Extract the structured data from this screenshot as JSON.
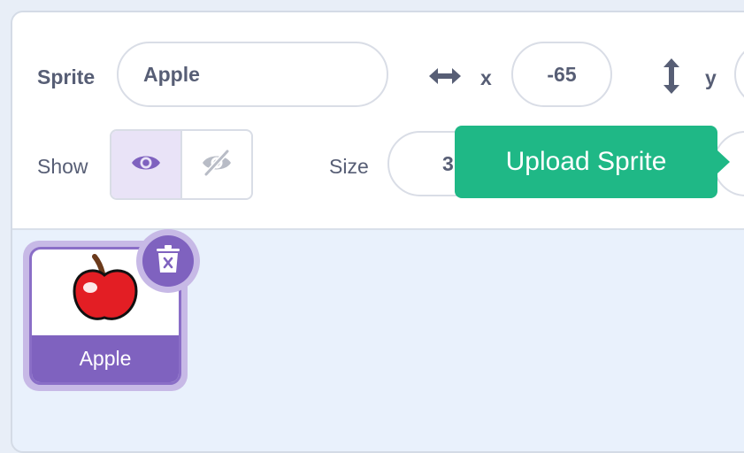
{
  "sprite_info": {
    "sprite_label": "Sprite",
    "sprite_name": "Apple",
    "x_label": "x",
    "x_value": "-65",
    "y_label": "y",
    "show_label": "Show",
    "size_label": "Size",
    "size_value_partial": "3"
  },
  "tooltip": {
    "text": "Upload Sprite"
  },
  "sprites": [
    {
      "name": "Apple",
      "selected": true
    }
  ],
  "colors": {
    "accent_purple": "#7f62bf",
    "tooltip_green": "#1fb886",
    "text": "#575e75"
  },
  "icons": {
    "x_axis": "horizontal-arrows-icon",
    "y_axis": "vertical-arrows-icon",
    "show": "eye-icon",
    "hide": "eye-slash-icon",
    "delete": "trash-icon",
    "thumbnail": "apple-icon"
  }
}
